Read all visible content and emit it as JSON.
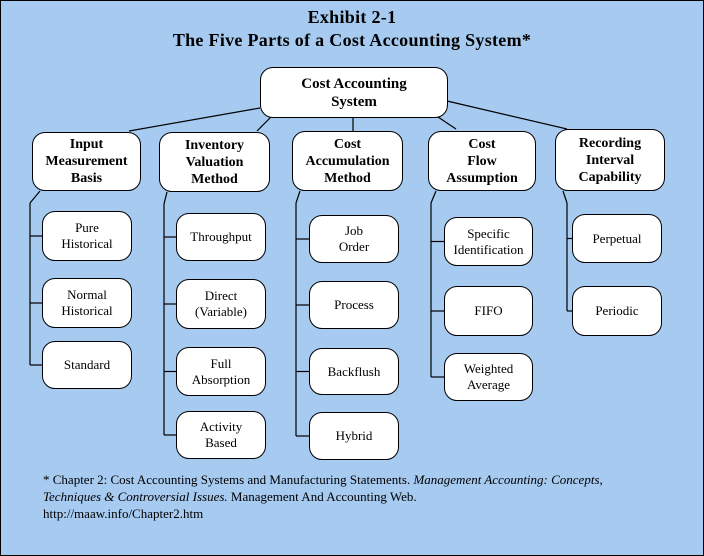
{
  "title": "Exhibit 2-1",
  "subtitle": "The Five Parts of a Cost Accounting System*",
  "colors": {
    "background": "#A6CAF0",
    "box_fill": "#FFFFFF",
    "line": "#000000"
  },
  "root": {
    "label": "Cost Accounting\nSystem"
  },
  "categories": [
    {
      "label": "Input\nMeasurement\nBasis",
      "children": [
        "Pure\nHistorical",
        "Normal\nHistorical",
        "Standard"
      ]
    },
    {
      "label": "Inventory\nValuation\nMethod",
      "children": [
        "Throughput",
        "Direct\n(Variable)",
        "Full\nAbsorption",
        "Activity\nBased"
      ]
    },
    {
      "label": "Cost\nAccumulation\nMethod",
      "children": [
        "Job\nOrder",
        "Process",
        "Backflush",
        "Hybrid"
      ]
    },
    {
      "label": "Cost\nFlow\nAssumption",
      "children": [
        "Specific\nIdentification",
        "FIFO",
        "Weighted\nAverage"
      ]
    },
    {
      "label": "Recording\nInterval\nCapability",
      "children": [
        "Perpetual",
        "Periodic"
      ]
    }
  ],
  "footnote": {
    "prefix": "* Chapter 2: Cost Accounting Systems and Manufacturing Statements. ",
    "italic": "Management Accounting: Concepts, Techniques & Controversial Issues.",
    "suffix": " Management And Accounting Web.",
    "url": "http://maaw.info/Chapter2.htm"
  }
}
